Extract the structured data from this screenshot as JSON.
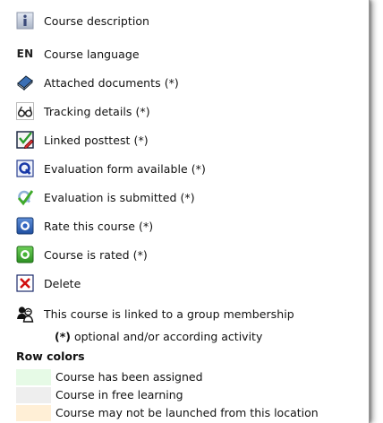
{
  "legend": {
    "items": [
      {
        "icon": "info-icon",
        "label": "Course description"
      },
      {
        "icon": "language-en-icon",
        "icon_text": "EN",
        "label": "Course language"
      },
      {
        "icon": "book-icon",
        "label": "Attached documents (*)"
      },
      {
        "icon": "glasses-icon",
        "label": "Tracking details (*)"
      },
      {
        "icon": "posttest-icon",
        "label": "Linked posttest (*)"
      },
      {
        "icon": "evaluation-q-icon",
        "label": "Evaluation form available (*)"
      },
      {
        "icon": "evaluation-submitted-icon",
        "label": "Evaluation is submitted (*)"
      },
      {
        "icon": "rate-course-icon",
        "label": "Rate this course (*)"
      },
      {
        "icon": "course-rated-icon",
        "label": "Course is rated (*)"
      },
      {
        "icon": "delete-x-icon",
        "label": "Delete"
      },
      {
        "icon": "group-membership-icon",
        "label": "This course is linked to a group membership"
      }
    ],
    "note_marker": "(*)",
    "note_text": " optional and/or according activity",
    "row_colors_title": "Row colors",
    "row_colors": [
      {
        "color": "#e6fae6",
        "label": "Course has been assigned"
      },
      {
        "color": "#eeeeee",
        "label": "Course in free learning"
      },
      {
        "color": "#ffefd6",
        "label": "Course may not be launched from this location"
      }
    ]
  }
}
